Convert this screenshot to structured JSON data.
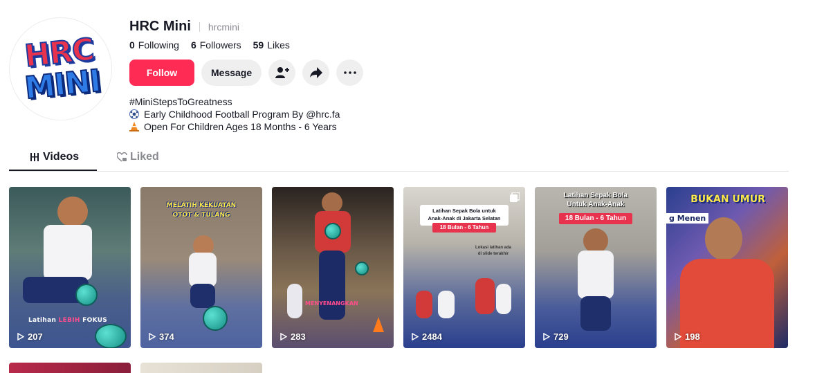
{
  "profile": {
    "display_name": "HRC Mini",
    "handle": "hrcmini",
    "avatar_logo": {
      "line1": "HRC",
      "line2": "MINI"
    },
    "stats": [
      {
        "count": "0",
        "label": "Following"
      },
      {
        "count": "6",
        "label": "Followers"
      },
      {
        "count": "59",
        "label": "Likes"
      }
    ],
    "actions": {
      "follow_label": "Follow",
      "message_label": "Message",
      "icons": [
        "add-friend-icon",
        "share-icon",
        "more-icon"
      ]
    },
    "bio": {
      "line1": "#MiniStepsToGreatness",
      "line2": "Early Childhood Football Program By @hrc.fa",
      "line3": "Open For Children Ages 18 Months - 6 Years"
    }
  },
  "tabs": {
    "videos_label": "Videos",
    "liked_label": "Liked"
  },
  "videos": [
    {
      "views": "207",
      "overlay": [
        "Latihan ",
        "LEBIH",
        " FOKUS"
      ]
    },
    {
      "views": "374",
      "overlay": [
        "MELATIH KEKUATAN",
        "OTOT & TULANG"
      ]
    },
    {
      "views": "283",
      "overlay": [
        "MENYENANGKAN"
      ]
    },
    {
      "views": "2484",
      "overlay": [
        "Latihan Sepak Bola untuk",
        "Anak-Anak di Jakarta Selatan",
        "18 Bulan - 6 Tahun",
        "Lokasi latihan ada",
        "di slide terakhir"
      ]
    },
    {
      "views": "729",
      "overlay": [
        "Latihan Sepak Bola",
        "Untuk Anak-Anak",
        "18 Bulan - 6 Tahun"
      ]
    },
    {
      "views": "198",
      "overlay": [
        "BUKAN UMUR",
        "g Menen"
      ]
    }
  ],
  "colors": {
    "accent": "#fe2c55",
    "text_primary": "#161823",
    "text_secondary": "#8a8b91"
  }
}
